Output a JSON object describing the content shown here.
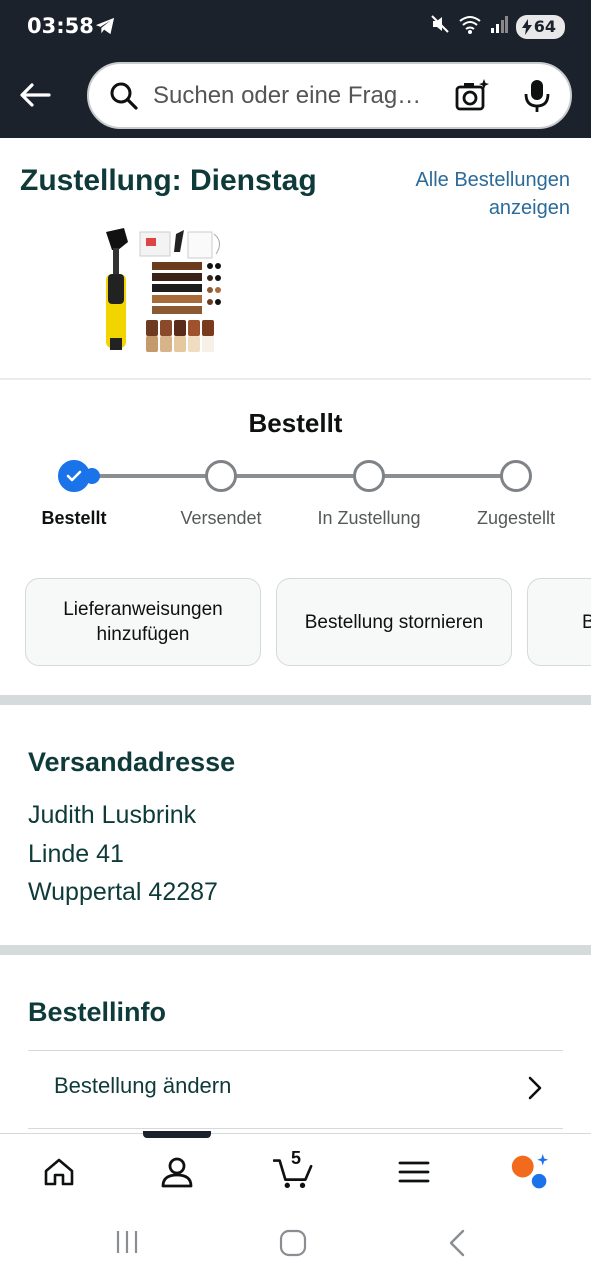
{
  "status_bar": {
    "time": "03:58",
    "battery": "64"
  },
  "search": {
    "placeholder": "Suchen oder eine Frag…"
  },
  "delivery": {
    "title": "Zustellung: Dienstag",
    "all_orders_line1": "Alle Bestellungen",
    "all_orders_line2": "anzeigen"
  },
  "order_status": {
    "heading": "Bestellt",
    "steps": [
      {
        "label": "Bestellt",
        "state": "done"
      },
      {
        "label": "Versendet",
        "state": "pending"
      },
      {
        "label": "In Zustellung",
        "state": "pending"
      },
      {
        "label": "Zugestellt",
        "state": "pending"
      }
    ]
  },
  "actions": {
    "add_instructions": "Lieferanweisungen hinzufügen",
    "cancel_order": "Bestellung stornieren",
    "partial": "B"
  },
  "shipping_address": {
    "title": "Versandadresse",
    "name": "Judith Lusbrink",
    "street": "Linde 41",
    "city": "Wuppertal 42287"
  },
  "order_info": {
    "title": "Bestellinfo",
    "change_order": "Bestellung ändern"
  },
  "bottom_nav": {
    "cart_count": "5"
  },
  "colors": {
    "header_bg": "#1b222c",
    "progress_blue": "#1a73e8",
    "link": "#2b6b9a",
    "teal_text": "#0f3a3a"
  }
}
